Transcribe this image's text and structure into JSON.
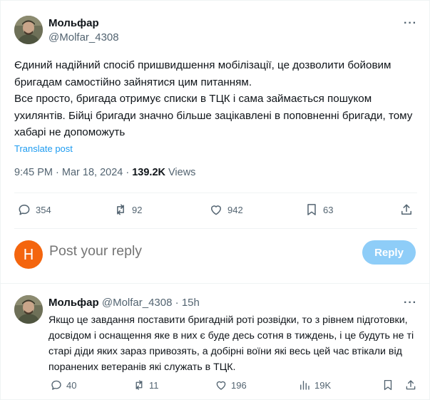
{
  "tweet": {
    "author_name": "Мольфар",
    "author_handle": "@Molfar_4308",
    "more_label": "···",
    "paragraphs": [
      "Єдиний надійний спосіб пришвидшення мобілізації, це дозволити бойовим бригадам самостійно зайнятися цим питанням.",
      "Все просто, бригада отримує списки в ТЦК і сама займається пошуком ухилянтів. Бійці бригади значно більше зацікавлені в поповненні бригади, тому хабарі не допоможуть"
    ],
    "translate_label": "Translate post",
    "time": "9:45 PM · Mar 18, 2024 · ",
    "views_count": "139.2K",
    "views_label": " Views",
    "stats": {
      "replies": "354",
      "reposts": "92",
      "likes": "942",
      "bookmarks": "63"
    }
  },
  "reply_box": {
    "avatar_letter": "H",
    "avatar_color": "#f4650e",
    "placeholder": "Post your reply",
    "button_label": "Reply",
    "button_color": "#8ecdf8"
  },
  "reply": {
    "author_name": "Мольфар",
    "author_handle": "@Molfar_4308",
    "dot": " · ",
    "time": "15h",
    "more_label": "···",
    "text": "Якщо це завдання поставити бригадній роті розвідки, то з рівнем підготовки, досвідом і оснащення яке в них є буде десь сотня в тиждень, і це будуть не ті старі діди яких зараз привозять, а добірні воїни які весь цей час втікали від поранених ветеранів які служать в ТЦК.",
    "stats": {
      "replies": "40",
      "reposts": "11",
      "likes": "196",
      "views": "19K"
    }
  },
  "colors": {
    "accent": "#1d9bf0",
    "muted": "#536471",
    "text": "#0f1419"
  }
}
